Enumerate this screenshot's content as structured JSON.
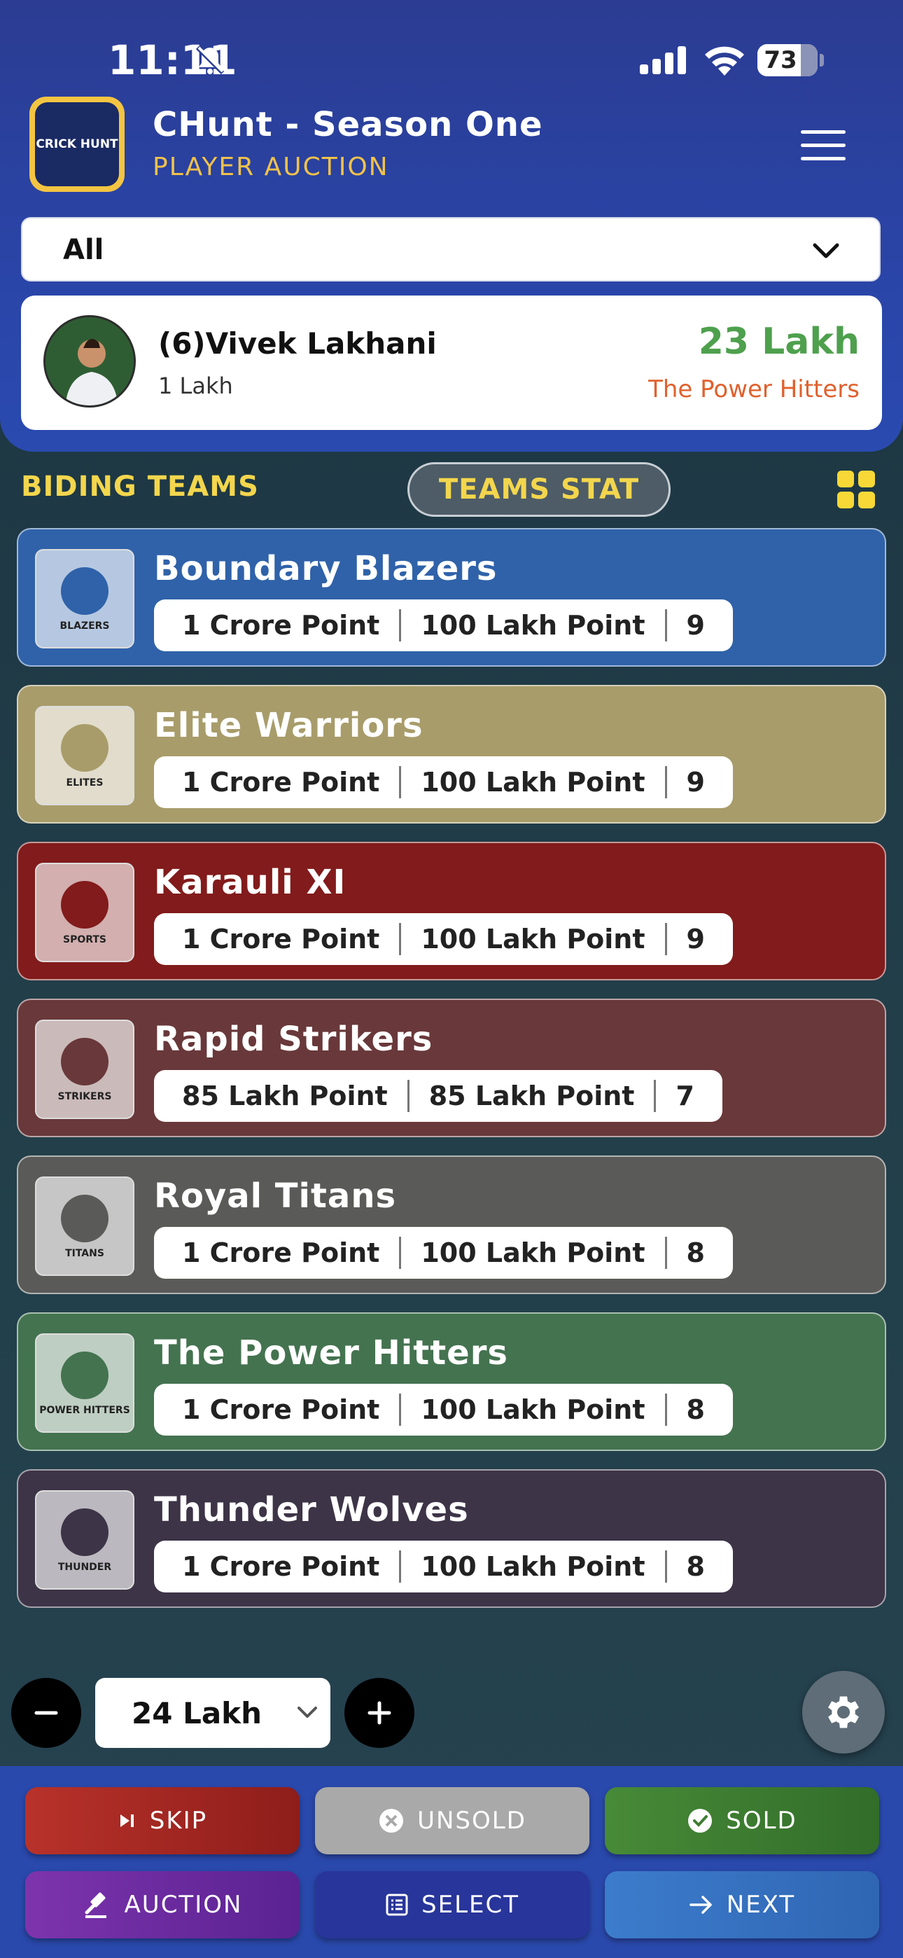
{
  "status_bar": {
    "time": "11:11",
    "battery": "73",
    "battery_level": 0.73
  },
  "header": {
    "logo_text": "CRICK HUNT",
    "title": "CHunt - Season One",
    "subtitle": "PLAYER AUCTION"
  },
  "filter": {
    "selected": "All"
  },
  "current_player": {
    "name": "(6)Vivek Lakhani",
    "base_price": "1 Lakh",
    "current_bid": "23 Lakh",
    "leading_team": "The Power Hitters"
  },
  "section": {
    "biding_label": "BIDING TEAMS",
    "teams_stat_label": "TEAMS STAT"
  },
  "teams": [
    {
      "name": "Boundary Blazers",
      "point1": "1 Crore Point",
      "point2": "100 Lakh Point",
      "count": "9",
      "color": "#2f62a9",
      "logo_text": "BLAZERS"
    },
    {
      "name": "Elite Warriors",
      "point1": "1 Crore Point",
      "point2": "100 Lakh Point",
      "count": "9",
      "color": "#a89c6a",
      "logo_text": "ELITES"
    },
    {
      "name": "Karauli XI",
      "point1": "1 Crore Point",
      "point2": "100 Lakh Point",
      "count": "9",
      "color": "#821b1b",
      "logo_text": "SPORTS"
    },
    {
      "name": "Rapid Strikers",
      "point1": "85 Lakh Point",
      "point2": "85 Lakh Point",
      "count": "7",
      "color": "#69383a",
      "logo_text": "STRIKERS"
    },
    {
      "name": "Royal Titans",
      "point1": "1 Crore Point",
      "point2": "100 Lakh Point",
      "count": "8",
      "color": "#5a5b58",
      "logo_text": "TITANS"
    },
    {
      "name": "The Power Hitters",
      "point1": "1 Crore Point",
      "point2": "100 Lakh Point",
      "count": "8",
      "color": "#447350",
      "logo_text": "POWER HITTERS"
    },
    {
      "name": "Thunder Wolves",
      "point1": "1 Crore Point",
      "point2": "100 Lakh Point",
      "count": "8",
      "color": "#3d3447",
      "logo_text": "THUNDER"
    }
  ],
  "bid_control": {
    "value": "24 Lakh"
  },
  "actions": {
    "skip": "SKIP",
    "unsold": "UNSOLD",
    "sold": "SOLD",
    "auction": "AUCTION",
    "select": "SELECT",
    "next": "NEXT"
  },
  "colors": {
    "skip": "#a82a22",
    "unsold": "#a8a8a8",
    "sold": "#3f7d33",
    "auction": "#7a2fa8",
    "select": "#2a3a9a",
    "next": "#3a78c6"
  }
}
